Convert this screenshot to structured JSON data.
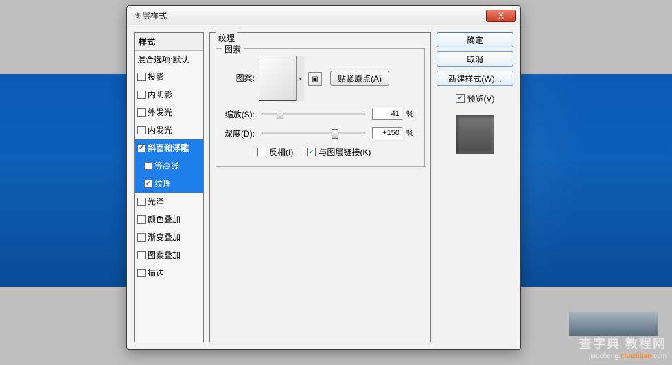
{
  "dialog": {
    "title": "图层样式",
    "close_symbol": "X"
  },
  "style_list": {
    "header": "样式",
    "blending": "混合选项:默认",
    "items": [
      {
        "label": "投影",
        "checked": false,
        "sub": false,
        "selected": false
      },
      {
        "label": "内阴影",
        "checked": false,
        "sub": false,
        "selected": false
      },
      {
        "label": "外发光",
        "checked": false,
        "sub": false,
        "selected": false
      },
      {
        "label": "内发光",
        "checked": false,
        "sub": false,
        "selected": false
      },
      {
        "label": "斜面和浮雕",
        "checked": true,
        "sub": false,
        "selected": true
      },
      {
        "label": "等高线",
        "checked": false,
        "sub": true,
        "selected": true
      },
      {
        "label": "纹理",
        "checked": true,
        "sub": true,
        "selected": true
      },
      {
        "label": "光泽",
        "checked": false,
        "sub": false,
        "selected": false
      },
      {
        "label": "颜色叠加",
        "checked": false,
        "sub": false,
        "selected": false
      },
      {
        "label": "渐变叠加",
        "checked": false,
        "sub": false,
        "selected": false
      },
      {
        "label": "图案叠加",
        "checked": false,
        "sub": false,
        "selected": false
      },
      {
        "label": "描边",
        "checked": false,
        "sub": false,
        "selected": false
      }
    ]
  },
  "panel": {
    "title": "纹理",
    "fieldset": "图素",
    "pattern_label": "图案:",
    "snap_origin": "贴紧原点(A)",
    "scale_label": "缩放(S):",
    "scale_value": "41",
    "scale_unit": "%",
    "depth_label": "深度(D):",
    "depth_value": "+150",
    "depth_unit": "%",
    "invert_label": "反相(I)",
    "link_label": "与图层链接(K)",
    "dd_glyph": "▾",
    "new_glyph": "▣"
  },
  "actions": {
    "ok": "确定",
    "cancel": "取消",
    "new_style": "新建样式(W)...",
    "preview": "预览(V)"
  },
  "watermark": {
    "line1": "查字典 教程网",
    "line2_plain": "jiaocheng.",
    "line2_b": "chazidian",
    "line2_tail": ".com"
  }
}
